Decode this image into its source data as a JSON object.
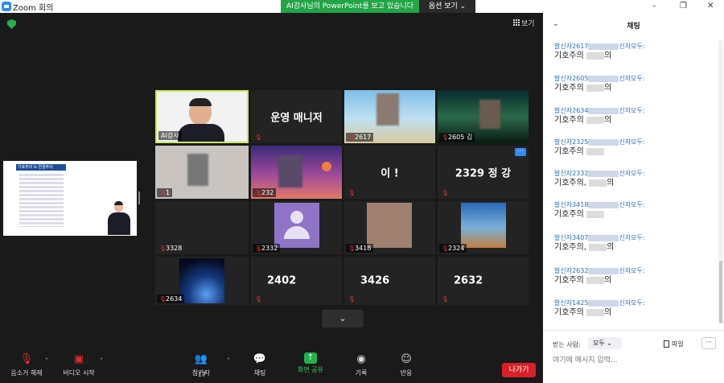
{
  "app": {
    "title": "Zoom 회의"
  },
  "share_banner": "AI강사님의 PowerPoint를 보고 있습니다",
  "view_options": "옵션 보기",
  "view_button": "보기",
  "shared_slide": {
    "heading": "기호주의 & 연결주의"
  },
  "tiles": [
    {
      "label": "AI강사",
      "big": ""
    },
    {
      "label": "",
      "big": "운영 매니저"
    },
    {
      "label": "2617",
      "big": ""
    },
    {
      "label": "2605 김",
      "big": ""
    },
    {
      "label": "1",
      "big": ""
    },
    {
      "label": "232",
      "big": ""
    },
    {
      "label": "",
      "big": "이 !"
    },
    {
      "label": "",
      "big": "2329 정 강"
    },
    {
      "label": "3328",
      "big": ""
    },
    {
      "label": "2332",
      "big": ""
    },
    {
      "label": "3418",
      "big": ""
    },
    {
      "label": "2324",
      "big": ""
    },
    {
      "label": "2634",
      "big": ""
    },
    {
      "label": "",
      "big": "2402"
    },
    {
      "label": "",
      "big": "3426"
    },
    {
      "label": "",
      "big": "2632"
    }
  ],
  "toolbar": {
    "unmute": "음소거 해제",
    "video": "비디오 시작",
    "participants": "참가자",
    "participants_count": "17",
    "chat": "채팅",
    "share": "화면 공유",
    "record": "기록",
    "reactions": "반응",
    "leave": "나가기"
  },
  "chat": {
    "title": "채팅",
    "messages": [
      {
        "sender": "발신자2617",
        "to": "신자모두:",
        "text": "기호주의 ",
        "tail": "의"
      },
      {
        "sender": "발신자2605",
        "to": "신자모두:",
        "text": "기호주의 ",
        "tail": "의"
      },
      {
        "sender": "발신자2634",
        "to": "신자모두:",
        "text": "기호주의 ",
        "tail": "의"
      },
      {
        "sender": "발신자2325",
        "to": "신자모두:",
        "text": "기호주의 ",
        "tail": ""
      },
      {
        "sender": "발신자2332",
        "to": "신자모두:",
        "text": "기호주의, ",
        "tail": "의"
      },
      {
        "sender": "발신자3418",
        "to": "신자모두:",
        "text": "기호주의 ",
        "tail": ""
      },
      {
        "sender": "발신자3407",
        "to": "신자모두:",
        "text": "기호주의, ",
        "tail": "의"
      },
      {
        "sender": "발신자2632",
        "to": "신자모두:",
        "text": "기호주의 ",
        "tail": "의"
      },
      {
        "sender": "발신자1425",
        "to": "신자모두:",
        "text": "기호주의 ",
        "tail": "의"
      }
    ],
    "to_label": "받는 사람:",
    "to_value": "모두",
    "file_label": "파일",
    "input_placeholder": "여기에 메시지 입력..."
  }
}
